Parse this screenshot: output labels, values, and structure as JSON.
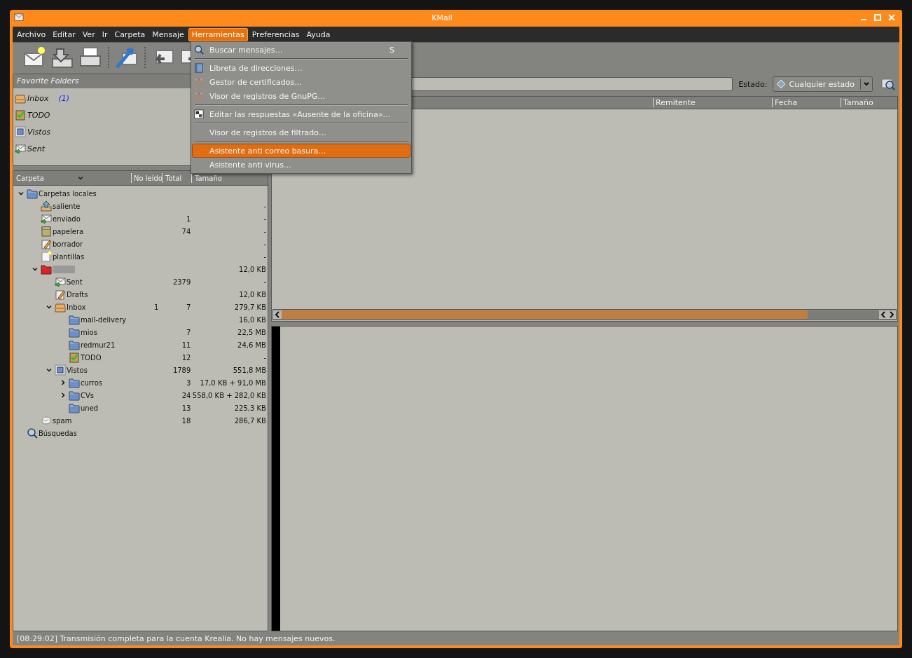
{
  "window": {
    "title": "KMail"
  },
  "menubar": [
    {
      "label": "Archivo",
      "selected": false
    },
    {
      "label": "Editar",
      "selected": false
    },
    {
      "label": "Ver",
      "selected": false
    },
    {
      "label": "Ir",
      "selected": false
    },
    {
      "label": "Carpeta",
      "selected": false
    },
    {
      "label": "Mensaje",
      "selected": false
    },
    {
      "label": "Herramientas",
      "selected": true
    },
    {
      "label": "Preferencias",
      "selected": false
    },
    {
      "label": "Ayuda",
      "selected": false
    }
  ],
  "toolbar": [
    {
      "kind": "new"
    },
    {
      "kind": "get"
    },
    {
      "kind": "print"
    },
    {
      "kind": "sendreceive"
    },
    {
      "kind": "reply"
    },
    {
      "kind": "forward"
    }
  ],
  "menu": [
    {
      "kind": "item",
      "label": "Buscar mensajes…",
      "shortcut": "S",
      "selected": false
    },
    {
      "kind": "separator"
    },
    {
      "kind": "item",
      "label": "Libreta de direcciones…",
      "selected": false
    },
    {
      "kind": "item",
      "label": "Gestor de certificados…",
      "selected": false
    },
    {
      "kind": "item",
      "label": "Visor de registros de GnuPG…",
      "selected": false
    },
    {
      "kind": "separator"
    },
    {
      "kind": "item",
      "label": "Editar las respuestas «Ausente de la oficina»…",
      "selected": false
    },
    {
      "kind": "separator"
    },
    {
      "kind": "item",
      "label": "Visor de registros de filtrado…",
      "selected": false
    },
    {
      "kind": "separator"
    },
    {
      "kind": "item",
      "label": "Asistente anti correo basura…",
      "selected": true
    },
    {
      "kind": "item",
      "label": "Asistente anti virus…",
      "selected": false
    }
  ],
  "favorites": {
    "title": "Favorite Folders",
    "items": [
      {
        "kind": "inbox",
        "label": "Inbox",
        "count": "(1)"
      },
      {
        "kind": "todo",
        "label": "TODO"
      },
      {
        "kind": "seen",
        "label": "Vistos"
      },
      {
        "kind": "sent",
        "label": "Sent"
      }
    ]
  },
  "folder_tree": {
    "columns": [
      "Carpeta",
      "No leído",
      "Total",
      "Tamaño"
    ],
    "items": [
      {
        "kind": "folder",
        "name": "Carpetas locales",
        "expanded": true,
        "children": [
          {
            "kind": "outbox",
            "name": "saliente",
            "size": "-"
          },
          {
            "kind": "sent",
            "name": "enviado",
            "total": "1",
            "size": "-"
          },
          {
            "kind": "trash",
            "name": "papelera",
            "total": "74",
            "size": "-"
          },
          {
            "kind": "drafts",
            "name": "borrador",
            "size": "-"
          },
          {
            "kind": "templates",
            "name": "plantillas",
            "size": "-"
          },
          {
            "kind": "account",
            "redacted": true,
            "size": "12,0 KB",
            "expanded": true,
            "children": [
              {
                "kind": "sent",
                "name": "Sent",
                "total": "2379",
                "size": "-"
              },
              {
                "kind": "drafts",
                "name": "Drafts",
                "size": "12,0 KB"
              },
              {
                "kind": "inbox",
                "name": "Inbox",
                "unread": "1",
                "total": "7",
                "size": "279,7 KB",
                "expanded": true,
                "children": [
                  {
                    "kind": "folder",
                    "name": "mail-delivery",
                    "size": "16,0 KB"
                  },
                  {
                    "kind": "folder",
                    "name": "mios",
                    "total": "7",
                    "size": "22,5 MB"
                  },
                  {
                    "kind": "folder",
                    "name": "redmur21",
                    "total": "11",
                    "size": "24,6 MB"
                  },
                  {
                    "kind": "todo",
                    "name": "TODO",
                    "total": "12",
                    "size": "-"
                  }
                ]
              },
              {
                "kind": "seen",
                "name": "Vistos",
                "total": "1789",
                "size": "551,8 MB",
                "expanded": true,
                "children": [
                  {
                    "kind": "folder",
                    "name": "curros",
                    "total": "3",
                    "size": "17,0 KB + 91,0 MB",
                    "expanded": false
                  },
                  {
                    "kind": "folder",
                    "name": "CVs",
                    "total": "24",
                    "size": "558,0 KB + 282,0 KB",
                    "expanded": false
                  },
                  {
                    "kind": "folder",
                    "name": "uned",
                    "total": "13",
                    "size": "225,3 KB"
                  }
                ]
              }
            ]
          },
          {
            "kind": "spam",
            "name": "spam",
            "total": "18",
            "size": "286,7 KB"
          }
        ]
      },
      {
        "kind": "search",
        "name": "Búsquedas"
      }
    ]
  },
  "filter": {
    "status_label": "Estado:",
    "status_value": "Cualquier estado"
  },
  "message_list": {
    "columns": [
      "Remitente",
      "Fecha",
      "Tamaño"
    ]
  },
  "status_bar": "[08:29:02] Transmisión completa para la cuenta Krealia. No hay mensajes nuevos."
}
